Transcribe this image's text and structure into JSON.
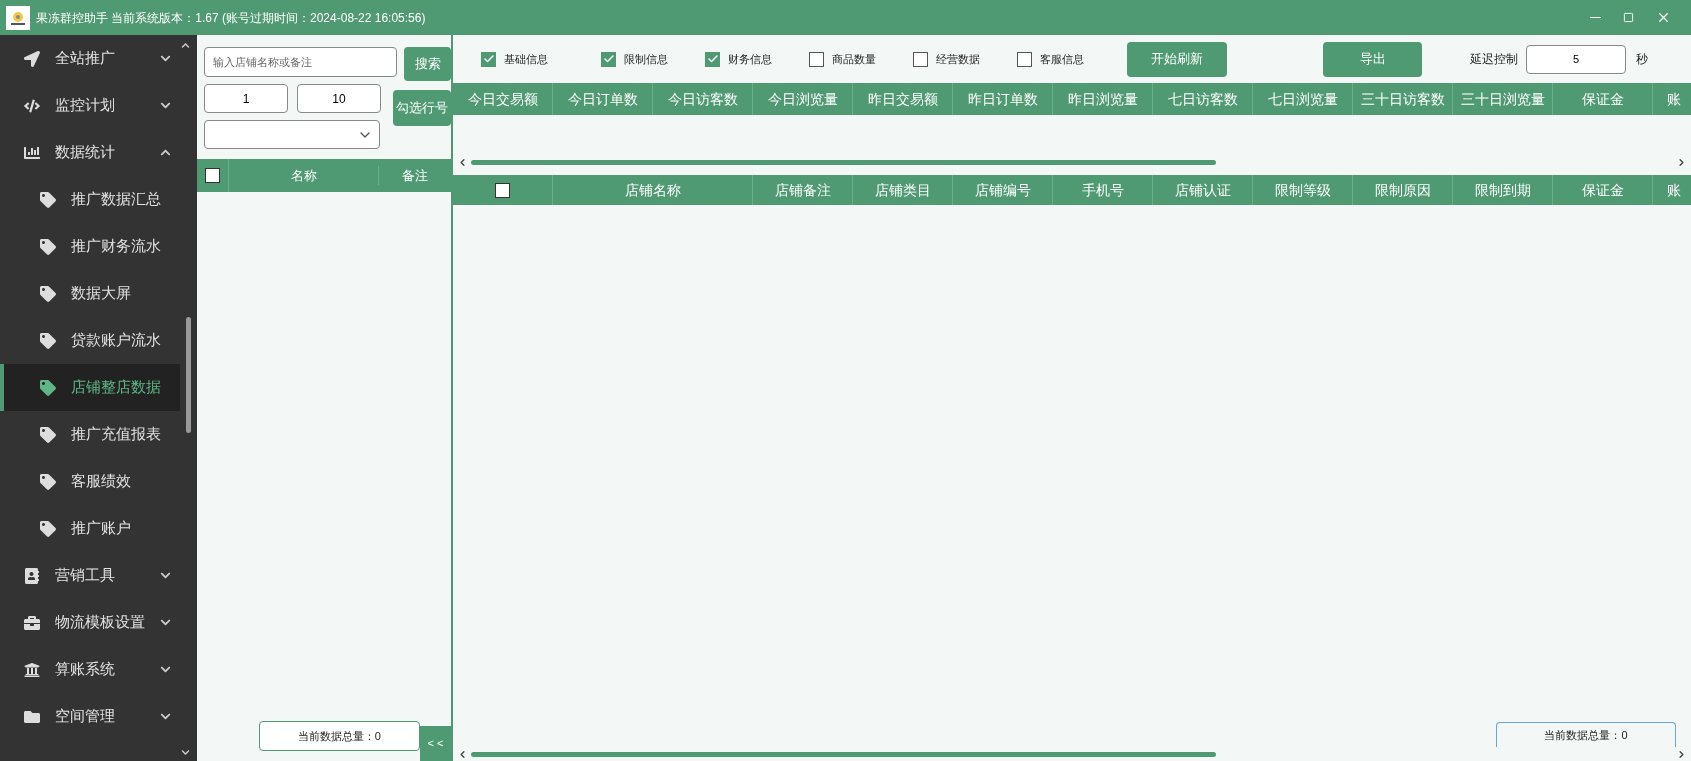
{
  "window": {
    "title": "果冻群控助手 当前系统版本：1.67 (账号过期时间：2024-08-22 16:05:56)"
  },
  "sidebar": {
    "items": [
      {
        "label": "全站推广",
        "expanded": false
      },
      {
        "label": "监控计划",
        "expanded": false
      },
      {
        "label": "数据统计",
        "expanded": true,
        "children": [
          {
            "label": "推广数据汇总",
            "selected": false
          },
          {
            "label": "推广财务流水",
            "selected": false
          },
          {
            "label": "数据大屏",
            "selected": false
          },
          {
            "label": "贷款账户流水",
            "selected": false
          },
          {
            "label": "店铺整店数据",
            "selected": true
          },
          {
            "label": "推广充值报表",
            "selected": false
          },
          {
            "label": "客服绩效",
            "selected": false
          },
          {
            "label": "推广账户",
            "selected": false
          }
        ]
      },
      {
        "label": "营销工具",
        "expanded": false
      },
      {
        "label": "物流模板设置",
        "expanded": false
      },
      {
        "label": "算账系统",
        "expanded": false
      },
      {
        "label": "空间管理",
        "expanded": false
      }
    ]
  },
  "shop_panel": {
    "search": {
      "placeholder": "输入店铺名称或备注"
    },
    "search_button": "搜索",
    "range_from": "1",
    "range_to": "10",
    "select_rows_button": "勾选行号",
    "table": {
      "select_all": false,
      "columns": [
        "名称",
        "备注"
      ]
    },
    "total": "当前数据总量：0",
    "collapse_button": "< <"
  },
  "data_panel": {
    "filters": [
      {
        "label": "基础信息",
        "checked": true
      },
      {
        "label": "限制信息",
        "checked": true
      },
      {
        "label": "财务信息",
        "checked": true
      },
      {
        "label": "商品数量",
        "checked": false
      },
      {
        "label": "经营数据",
        "checked": false
      },
      {
        "label": "客服信息",
        "checked": false
      }
    ],
    "refresh_button": "开始刷新",
    "export_button": "导出",
    "delay_label": "延迟控制",
    "delay_value": "5",
    "delay_unit": "秒",
    "stats_table": {
      "columns": [
        "今日交易额",
        "今日订单数",
        "今日访客数",
        "今日浏览量",
        "昨日交易额",
        "昨日订单数",
        "昨日浏览量",
        "七日访客数",
        "七日浏览量",
        "三十日访客数",
        "三十日浏览量",
        "保证金",
        "账"
      ]
    },
    "shop_table": {
      "select_all": false,
      "columns": [
        "店铺名称",
        "店铺备注",
        "店铺类目",
        "店铺编号",
        "手机号",
        "店铺认证",
        "限制等级",
        "限制原因",
        "限制到期",
        "保证金",
        "账"
      ]
    },
    "total": "当前数据总量：0"
  }
}
